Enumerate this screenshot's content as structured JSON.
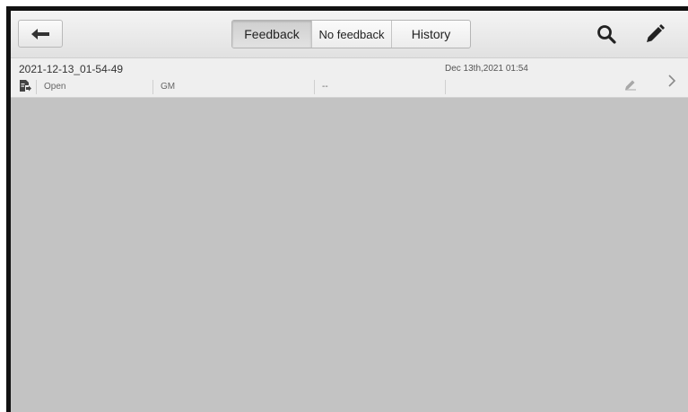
{
  "tabs": [
    {
      "label": "Feedback",
      "active": true
    },
    {
      "label": "No feedback",
      "active": false
    },
    {
      "label": "History",
      "active": false
    }
  ],
  "icons": {
    "back": "back-arrow-icon",
    "search": "search-icon",
    "edit": "pencil-icon",
    "document": "document-export-icon",
    "row_edit": "pencil-icon",
    "row_open": "chevron-right-icon"
  },
  "records": [
    {
      "title": "2021-12-13_01-54-49",
      "date": "Dec 13th,2021 01:54",
      "status": "Open",
      "make": "GM",
      "model": "--"
    }
  ],
  "colors": {
    "screen_bg": "#c3c3c3",
    "toolbar_bg": "#e9e9e9",
    "row_bg": "#efefef",
    "frame": "#111111"
  }
}
